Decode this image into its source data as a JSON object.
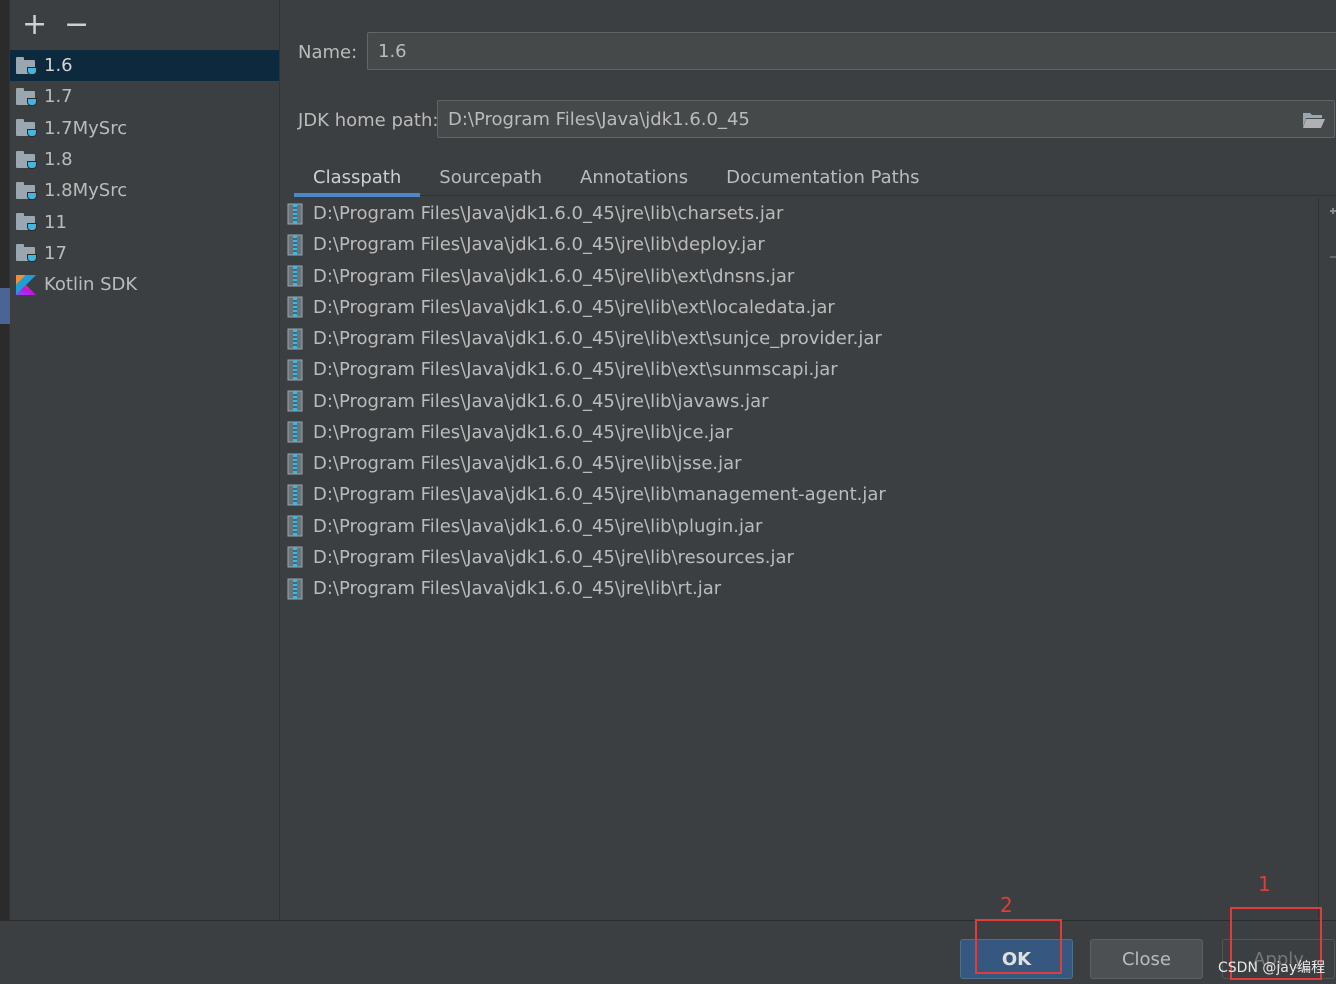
{
  "sidebar": {
    "add_label": "+",
    "remove_label": "−",
    "items": [
      {
        "label": "1.6"
      },
      {
        "label": "1.7"
      },
      {
        "label": "1.7MySrc"
      },
      {
        "label": "1.8"
      },
      {
        "label": "1.8MySrc"
      },
      {
        "label": "11"
      },
      {
        "label": "17"
      },
      {
        "label": "Kotlin SDK"
      }
    ],
    "selected_index": 0
  },
  "form": {
    "name_label": "Name:",
    "name_value": "1.6",
    "jdk_home_label": "JDK home path:",
    "jdk_home_value": "D:\\Program Files\\Java\\jdk1.6.0_45"
  },
  "tabs": [
    {
      "label": "Classpath"
    },
    {
      "label": "Sourcepath"
    },
    {
      "label": "Annotations"
    },
    {
      "label": "Documentation Paths"
    }
  ],
  "active_tab": "Classpath",
  "classpath": [
    "D:\\Program Files\\Java\\jdk1.6.0_45\\jre\\lib\\charsets.jar",
    "D:\\Program Files\\Java\\jdk1.6.0_45\\jre\\lib\\deploy.jar",
    "D:\\Program Files\\Java\\jdk1.6.0_45\\jre\\lib\\ext\\dnsns.jar",
    "D:\\Program Files\\Java\\jdk1.6.0_45\\jre\\lib\\ext\\localedata.jar",
    "D:\\Program Files\\Java\\jdk1.6.0_45\\jre\\lib\\ext\\sunjce_provider.jar",
    "D:\\Program Files\\Java\\jdk1.6.0_45\\jre\\lib\\ext\\sunmscapi.jar",
    "D:\\Program Files\\Java\\jdk1.6.0_45\\jre\\lib\\javaws.jar",
    "D:\\Program Files\\Java\\jdk1.6.0_45\\jre\\lib\\jce.jar",
    "D:\\Program Files\\Java\\jdk1.6.0_45\\jre\\lib\\jsse.jar",
    "D:\\Program Files\\Java\\jdk1.6.0_45\\jre\\lib\\management-agent.jar",
    "D:\\Program Files\\Java\\jdk1.6.0_45\\jre\\lib\\plugin.jar",
    "D:\\Program Files\\Java\\jdk1.6.0_45\\jre\\lib\\resources.jar",
    "D:\\Program Files\\Java\\jdk1.6.0_45\\jre\\lib\\rt.jar"
  ],
  "buttons": {
    "ok": "OK",
    "close": "Close",
    "apply": "Apply"
  },
  "annotations": {
    "one": "1",
    "two": "2"
  },
  "watermark": "CSDN @jay编程",
  "colors": {
    "background": "#3c3f41",
    "selection": "#0d293e",
    "accent": "#4a88c7",
    "annotation": "#e03c3c"
  },
  "icons": {
    "sdk": "jdk-folder-icon",
    "kotlin": "kotlin-icon",
    "jar": "jar-archive-icon",
    "browse": "folder-open-icon"
  }
}
